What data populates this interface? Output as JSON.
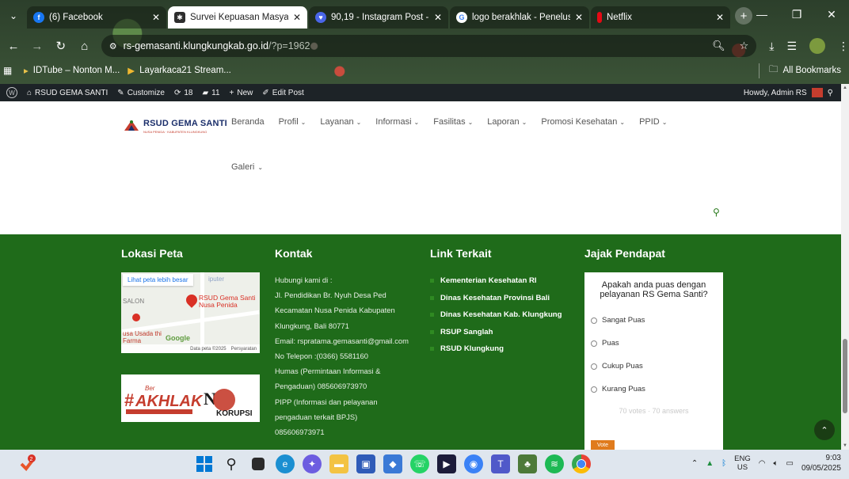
{
  "browser": {
    "tabs": [
      {
        "title": "(6) Facebook",
        "favicon": "facebook-icon",
        "color": "#1877f2"
      },
      {
        "title": "Survei Kepuasan Masyara",
        "favicon": "wordpress-icon",
        "color": "#2d2d2d",
        "active": true
      },
      {
        "title": "90,19 - Instagram Post -",
        "favicon": "heart-icon",
        "color": "#4a66e8"
      },
      {
        "title": "logo berakhlak - Penelusu",
        "favicon": "google-icon",
        "color": "#4285f4"
      },
      {
        "title": "Netflix",
        "favicon": "netflix-icon",
        "color": "#e50914"
      }
    ],
    "url_host": "rs-gemasanti.klungkungkab.go.id",
    "url_path": "/?p=1962",
    "bookmarks": [
      "IDTube – Nonton M...",
      "Layarkaca21 Stream..."
    ],
    "all_bookmarks": "All Bookmarks"
  },
  "wpbar": {
    "site": "RSUD GEMA SANTI",
    "customize": "Customize",
    "updates": "18",
    "comments": "11",
    "new": "New",
    "edit": "Edit Post",
    "howdy": "Howdy, Admin RS"
  },
  "site": {
    "logo": "RSUD GEMA SANTI",
    "logo_sub": "NUSA PENIDA · KABUPATEN KLUNGKUNG",
    "nav": [
      "Beranda",
      "Profil",
      "Layanan",
      "Informasi",
      "Fasilitas",
      "Laporan",
      "Promosi Kesehatan",
      "PPID"
    ],
    "nav_caret": [
      false,
      true,
      true,
      true,
      true,
      true,
      true,
      true
    ],
    "nav2": "Galeri"
  },
  "footer": {
    "lokasi_title": "Lokasi Peta",
    "map": {
      "bigger": "Lihat peta lebih besar",
      "pin_label": "RSUD Gema Santi Nusa Penida",
      "salon": "SALON",
      "usada": "usa Usada thi Farma",
      "iputer": "iputer",
      "google": "Google",
      "attrib": "Data peta ©2025",
      "terms": "Persyaratan"
    },
    "kontak_title": "Kontak",
    "kontak_lines": [
      "Hubungi kami di :",
      "Jl. Pendidikan Br. Nyuh Desa Ped",
      "Kecamatan Nusa Penida Kabupaten",
      "Klungkung, Bali 80771",
      "Email: rspratama.gemasanti@gmail.com",
      "No Telepon :(0366) 5581160",
      "Humas (Permintaan Informasi &",
      "Pengaduan) 085606973970",
      "PIPP (Informasi dan pelayanan",
      "pengaduan terkait BPJS)",
      "085606973971"
    ],
    "links_title": "Link Terkait",
    "links": [
      "Kementerian Kesehatan RI",
      "Dinas Kesehatan Provinsi Bali",
      "Dinas Kesehatan Kab. Klungkung",
      "RSUP Sanglah",
      "RSUD Klungkung"
    ],
    "poll_title": "Jajak Pendapat",
    "poll_question": "Apakah anda puas dengan pelayanan RS Gema Santi?",
    "poll_options": [
      "Sangat Puas",
      "Puas",
      "Cukup Puas",
      "Kurang Puas"
    ],
    "poll_votes": "70 votes · 70 answers",
    "vote_label": "Vote",
    "akhlak": "AKHLAK",
    "akhlak_ber": "Ber",
    "korupsi": "KORUPSI"
  },
  "taskbar": {
    "lang1": "ENG",
    "lang2": "US",
    "time": "9:03",
    "date": "09/05/2025",
    "badge": "2"
  }
}
